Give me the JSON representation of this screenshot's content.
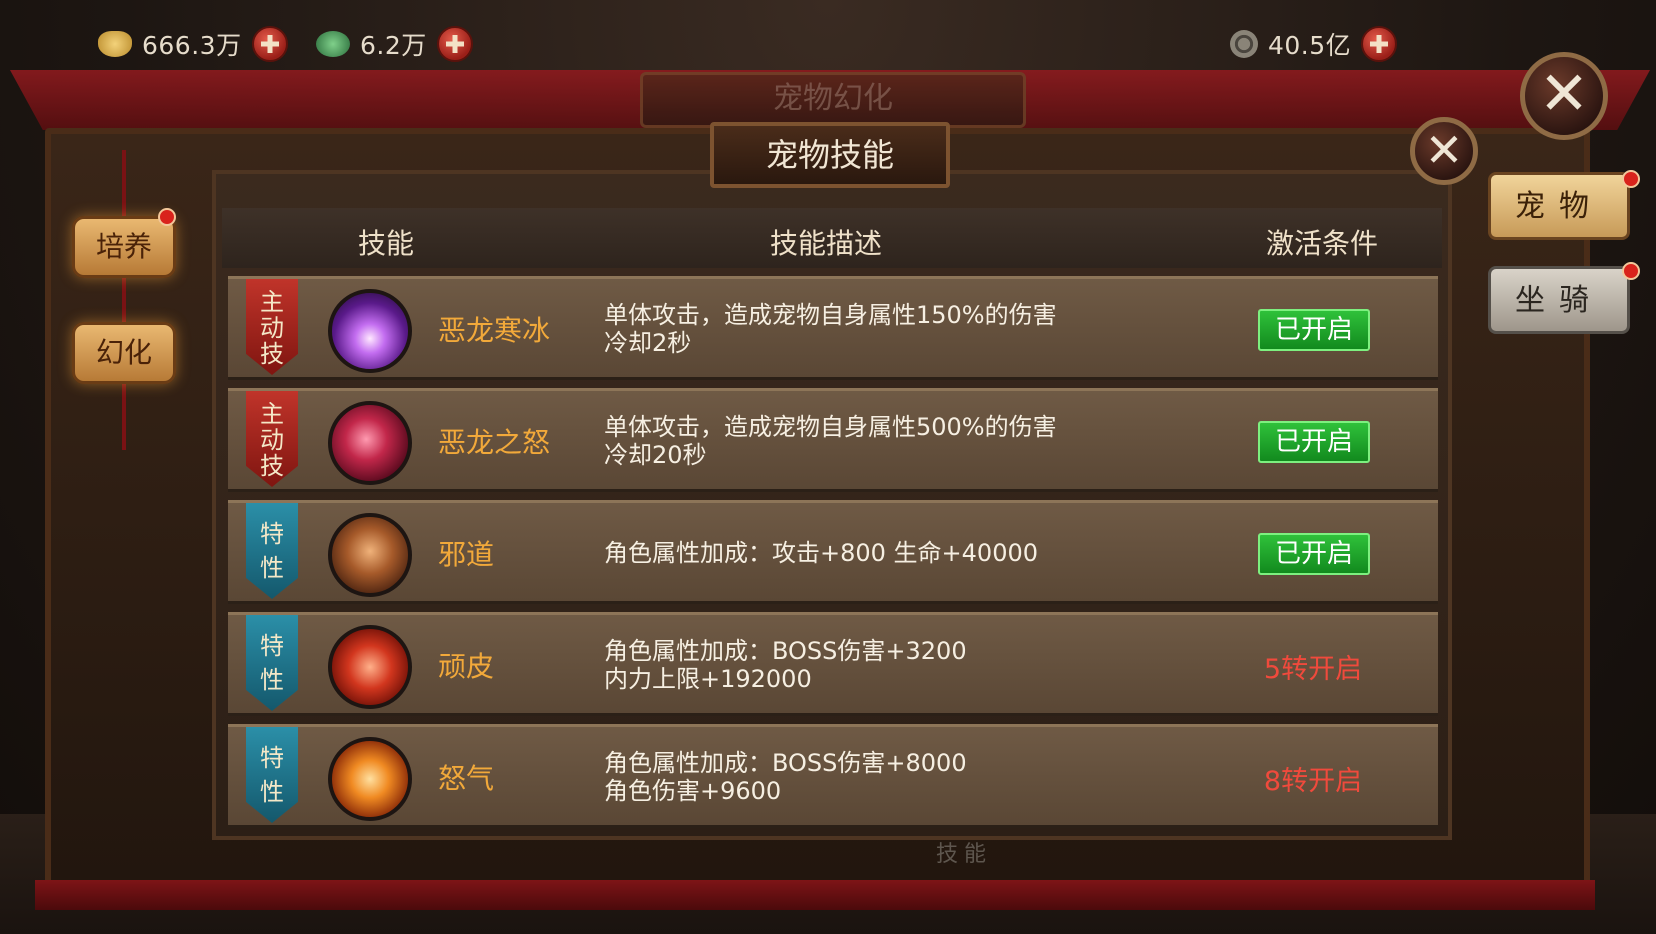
{
  "currencies": [
    {
      "icon": "gold-ingot-icon",
      "value": "666.3万"
    },
    {
      "icon": "jade-coin-icon",
      "value": "6.2万"
    },
    {
      "icon": "copper-coin-icon",
      "value": "40.5亿"
    }
  ],
  "background_title": "宠物幻化",
  "dialog": {
    "title": "宠物技能",
    "headers": {
      "skill": "技能",
      "description": "技能描述",
      "condition": "激活条件"
    },
    "skills": [
      {
        "type_label": [
          "主",
          "动",
          "技"
        ],
        "type_color": "red",
        "icon": "purple-burst-icon",
        "name": "恶龙寒冰",
        "desc": [
          "单体攻击，造成宠物自身属性150%的伤害",
          "冷却2秒"
        ],
        "status": "已开启",
        "active": true
      },
      {
        "type_label": [
          "主",
          "动",
          "技"
        ],
        "type_color": "red",
        "icon": "dragon-claw-icon",
        "name": "恶龙之怒",
        "desc": [
          "单体攻击，造成宠物自身属性500%的伤害",
          "冷却20秒"
        ],
        "status": "已开启",
        "active": true
      },
      {
        "type_label": [
          "特",
          "性"
        ],
        "type_color": "blue",
        "icon": "evil-way-icon",
        "name": "邪道",
        "desc": [
          "角色属性加成：攻击+800 生命+40000"
        ],
        "status": "已开启",
        "active": true
      },
      {
        "type_label": [
          "特",
          "性"
        ],
        "type_color": "blue",
        "icon": "tough-skin-icon",
        "name": "顽皮",
        "desc": [
          "角色属性加成：BOSS伤害+3200",
          "内力上限+192000"
        ],
        "status": "5转开启",
        "active": false
      },
      {
        "type_label": [
          "特",
          "性"
        ],
        "type_color": "blue",
        "icon": "rage-icon",
        "name": "怒气",
        "desc": [
          "角色属性加成：BOSS伤害+8000",
          "角色伤害+9600"
        ],
        "status": "8转开启",
        "active": false
      }
    ]
  },
  "left_tabs": {
    "cultivate": "培养",
    "transform": "幻化"
  },
  "right_tabs": {
    "pet": "宠物",
    "mount": "坐骑"
  },
  "footer_label": "技能",
  "colors": {
    "skill_name": "#f2a93a",
    "active_green": "#2fc13a",
    "locked_red": "#f04a3c"
  }
}
